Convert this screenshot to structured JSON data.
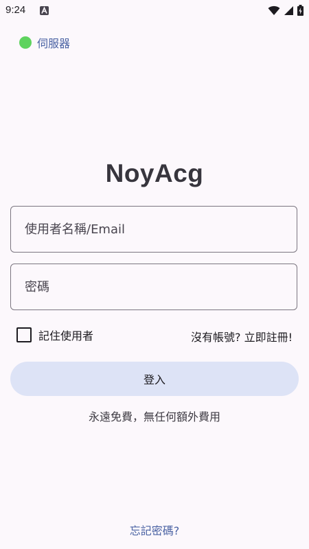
{
  "status_bar": {
    "time": "9:24",
    "notification_icon": "android-a-icon",
    "wifi_icon": "wifi-icon",
    "signal_icon": "cell-signal-icon",
    "battery_icon": "battery-charging-icon"
  },
  "server": {
    "label": "伺服器",
    "status_color": "#5fd35f"
  },
  "app": {
    "title": "NoyAcg"
  },
  "form": {
    "username_placeholder": "使用者名稱/Email",
    "username_value": "",
    "password_placeholder": "密碼",
    "password_value": "",
    "remember_label": "記住使用者",
    "remember_checked": false,
    "register_link": "沒有帳號? 立即註冊!",
    "login_button": "登入",
    "free_note": "永遠免費，無任何額外費用",
    "forgot_link": "忘記密碼?"
  },
  "colors": {
    "background": "#fcf8fc",
    "accent_link": "#4a62a3",
    "button_bg": "#dde3f6",
    "title": "#37353d"
  }
}
